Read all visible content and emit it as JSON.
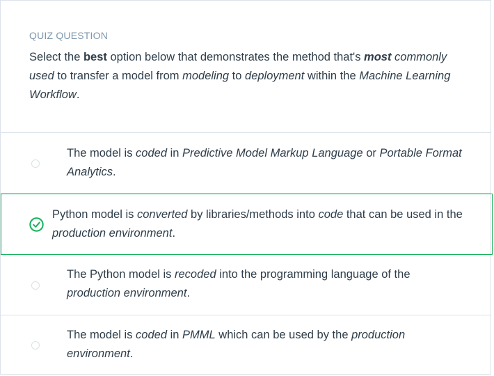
{
  "quiz": {
    "eyebrow": "QUIZ QUESTION",
    "question": {
      "t1": "Select the ",
      "b1": "best",
      "t2": " option below that demonstrates the method that's ",
      "b2": "most",
      "i1": " commonly used",
      "t3": " to transfer a model from ",
      "i2": "modeling",
      "t4": " to ",
      "i3": "deployment",
      "t5": " within the ",
      "i4": "Machine Learning Workflow",
      "t6": "."
    },
    "options": [
      {
        "selected": false,
        "parts": {
          "a": "The model is ",
          "b": "coded",
          "c": " in ",
          "d": "Predictive Model Markup Language",
          "e": " or ",
          "f": "Portable Format Analytics",
          "g": "."
        }
      },
      {
        "selected": true,
        "parts": {
          "a": "Python model is ",
          "b": "converted",
          "c": " by libraries/methods into ",
          "d": "code",
          "e": " that can be used in the ",
          "f": "production environment",
          "g": "."
        }
      },
      {
        "selected": false,
        "parts": {
          "a": "The Python model is ",
          "b": "recoded",
          "c": " into the programming language of the ",
          "d": "production environment",
          "e": "."
        }
      },
      {
        "selected": false,
        "parts": {
          "a": "The model is ",
          "b": "coded",
          "c": " in ",
          "d": "PMML",
          "e": " which can be used by the ",
          "f": "production environment",
          "g": "."
        }
      }
    ],
    "colors": {
      "selected_border": "#16b35a",
      "check": "#16b35a",
      "text": "#2e3d49",
      "eyebrow": "#7d97ad",
      "divider": "#dbe2e8"
    },
    "icons": {
      "selected": "check-circle-icon",
      "unselected": "radio-circle-icon"
    }
  }
}
